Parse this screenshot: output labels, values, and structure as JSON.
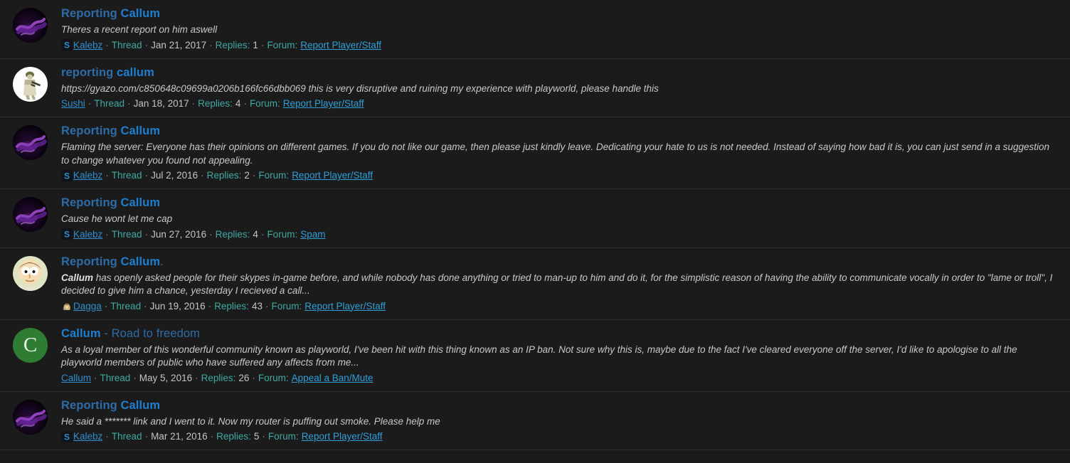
{
  "theme": {
    "page_background": "#1a1a1a",
    "row_background": "#1b1b1b",
    "row_separator": "#2e2e2e",
    "title_link": "#2d6ca8",
    "title_highlight": "#1e7fd1",
    "snippet_text": "#c8c8c8",
    "meta_label": "#3fa9a0",
    "meta_date": "#c4c4c4",
    "user_link": "#2f8fd0",
    "forum_link": "#2f9fd8"
  },
  "meta_labels": {
    "thread": "Thread",
    "replies": "Replies:",
    "forum": "Forum:",
    "separator": "·"
  },
  "results": [
    {
      "title_prefix": "Reporting ",
      "title_highlight": "Callum",
      "title_suffix": "",
      "snippet_bold": "",
      "snippet": "Theres a recent report on him aswell",
      "user": "Kalebz",
      "avatar_type": "smoke",
      "mini_avatar": "kalebz-mini",
      "type": "Thread",
      "date": "Jan 21, 2017",
      "replies": "1",
      "forum": "Report Player/Staff"
    },
    {
      "title_prefix": "reporting ",
      "title_highlight": "callum",
      "title_suffix": "",
      "snippet_bold": "",
      "snippet": "https://gyazo.com/c850648c09699a0206b166fc66dbb069 this is very disruptive and ruining my experience with playworld, please handle this",
      "user": "Sushi",
      "avatar_type": "soldier",
      "mini_avatar": "none",
      "type": "Thread",
      "date": "Jan 18, 2017",
      "replies": "4",
      "forum": "Report Player/Staff"
    },
    {
      "title_prefix": "Reporting ",
      "title_highlight": "Callum",
      "title_suffix": "",
      "snippet_bold": "",
      "snippet": "Flaming the server: Everyone has their opinions on different games. If you do not like our game, then please just kindly leave. Dedicating your hate to us is not needed. Instead of saying how bad it is, you can just send in a suggestion to change whatever you found not appealing.",
      "user": "Kalebz",
      "avatar_type": "smoke",
      "mini_avatar": "kalebz-mini",
      "type": "Thread",
      "date": "Jul 2, 2016",
      "replies": "2",
      "forum": "Report Player/Staff"
    },
    {
      "title_prefix": "Reporting ",
      "title_highlight": "Callum",
      "title_suffix": "",
      "snippet_bold": "",
      "snippet": "Cause he wont let me cap",
      "user": "Kalebz",
      "avatar_type": "smoke",
      "mini_avatar": "kalebz-mini",
      "type": "Thread",
      "date": "Jun 27, 2016",
      "replies": "4",
      "forum": "Spam"
    },
    {
      "title_prefix": "Reporting ",
      "title_highlight": "Callum",
      "title_suffix": ".",
      "snippet_bold": "Callum",
      "snippet": " has openly asked people for their skypes in-game before, and while nobody has done anything or tried to man-up to him and do it, for the simplistic reason of having the ability to communicate vocally in order to ʺlame or trollʺ, I decided to give him a chance, yesterday I recieved a call...",
      "user": "Dagga",
      "avatar_type": "cartoon-man",
      "mini_avatar": "dagga-mini",
      "type": "Thread",
      "date": "Jun 19, 2016",
      "replies": "43",
      "forum": "Report Player/Staff"
    },
    {
      "title_prefix": "",
      "title_highlight": "Callum",
      "title_suffix": " - Road to freedom",
      "snippet_bold": "",
      "snippet": "As a loyal member of this wonderful community known as playworld, I've been hit with this thing known as an IP ban. Not sure why this is, maybe due to the fact I've cleared everyone off the server, I'd like to apologise to all the playworld members of public who have suffered any affects from me...",
      "user": "Callum",
      "avatar_type": "letter-c",
      "mini_avatar": "none",
      "type": "Thread",
      "date": "May 5, 2016",
      "replies": "26",
      "forum": "Appeal a Ban/Mute"
    },
    {
      "title_prefix": "Reporting ",
      "title_highlight": "Callum",
      "title_suffix": "",
      "snippet_bold": "",
      "snippet": "He said a ******* link and I went to it. Now my router is puffing out smoke. Please help me",
      "user": "Kalebz",
      "avatar_type": "smoke",
      "mini_avatar": "kalebz-mini",
      "type": "Thread",
      "date": "Mar 21, 2016",
      "replies": "5",
      "forum": "Report Player/Staff"
    }
  ]
}
